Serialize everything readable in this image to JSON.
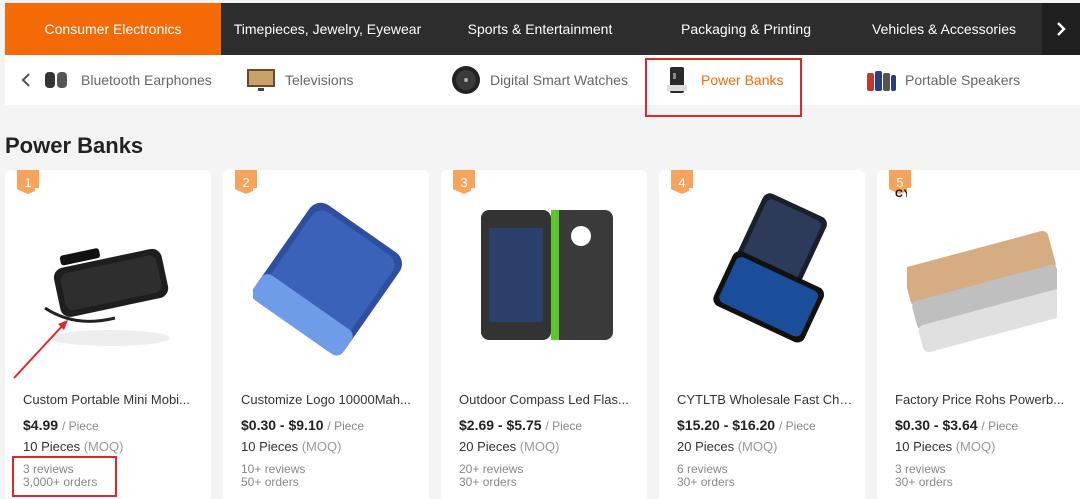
{
  "top_categories": [
    {
      "label": "Consumer Electronics",
      "active": true
    },
    {
      "label": "Timepieces, Jewelry, Eyewear",
      "active": false
    },
    {
      "label": "Sports & Entertainment",
      "active": false
    },
    {
      "label": "Packaging & Printing",
      "active": false
    },
    {
      "label": "Vehicles & Accessories",
      "active": false
    }
  ],
  "sub_categories": [
    {
      "label": "Bluetooth Earphones",
      "icon": "earphones-icon",
      "active": false
    },
    {
      "label": "Televisions",
      "icon": "television-icon",
      "active": false
    },
    {
      "label": "Digital Smart Watches",
      "icon": "smartwatch-icon",
      "active": false
    },
    {
      "label": "Power Banks",
      "icon": "power-bank-icon",
      "active": true
    },
    {
      "label": "Portable Speakers",
      "icon": "speaker-icon",
      "active": false
    }
  ],
  "section": {
    "title": "Power Banks"
  },
  "colors": {
    "accent": "#f46a06",
    "highlight": "#e0262a",
    "topbar": "#2d2d2d"
  },
  "products": [
    {
      "rank": "1",
      "title": "Custom Portable Mini Mobi...",
      "price": "$4.99",
      "unit": "/ Piece",
      "moq_qty": "10 Pieces",
      "moq_tag": "(MOQ)",
      "reviews": "3 reviews",
      "orders": "3,000+ orders"
    },
    {
      "rank": "2",
      "title": "Customize Logo 10000Mah...",
      "price": "$0.30 - $9.10",
      "unit": "/ Piece",
      "moq_qty": "10 Pieces",
      "moq_tag": "(MOQ)",
      "reviews": "10+ reviews",
      "orders": "50+ orders"
    },
    {
      "rank": "3",
      "title": "Outdoor Compass Led Flas...",
      "price": "$2.69 - $5.75",
      "unit": "/ Piece",
      "moq_qty": "20 Pieces",
      "moq_tag": "(MOQ)",
      "reviews": "20+ reviews",
      "orders": "30+ orders"
    },
    {
      "rank": "4",
      "title": "CYTLTB Wholesale Fast Cha...",
      "price": "$15.20 - $16.20",
      "unit": "/ Piece",
      "moq_qty": "20 Pieces",
      "moq_tag": "(MOQ)",
      "reviews": "6 reviews",
      "orders": "30+ orders"
    },
    {
      "rank": "5",
      "title": "Factory Price Rohs Powerb...",
      "price": "$0.30 - $3.64",
      "unit": "/ Piece",
      "moq_qty": "10 Pieces",
      "moq_tag": "(MOQ)",
      "reviews": "3 reviews",
      "orders": "30+ orders",
      "brand_mark": "CYTLTB"
    }
  ]
}
